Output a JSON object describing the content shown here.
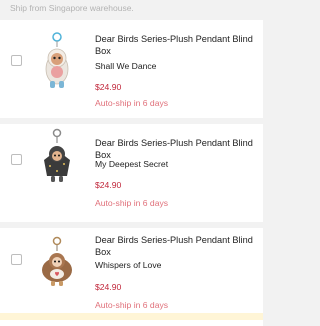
{
  "header": {
    "ship_text": "Ship from Singapore warehouse."
  },
  "items": [
    {
      "title": "Dear Birds Series-Plush Pendant Blind Box",
      "variant": "Shall We Dance",
      "price": "$24.90",
      "auto_ship": "Auto-ship in 6 days",
      "icon": "white-owl-plush-pendant",
      "color": "#e8ded2"
    },
    {
      "title": "Dear Birds Series-Plush Pendant Blind Box",
      "variant": "My Deepest Secret",
      "price": "$24.90",
      "auto_ship": "Auto-ship in 6 days",
      "icon": "black-bird-plush-pendant",
      "color": "#3a3a3a"
    },
    {
      "title": "Dear Birds Series-Plush Pendant Blind Box",
      "variant": "Whispers of Love",
      "price": "$24.90",
      "auto_ship": "Auto-ship in 6 days",
      "icon": "brown-owl-plush-pendant",
      "color": "#9a6a45"
    }
  ],
  "colors": {
    "price": "#c0263a",
    "auto_ship": "#e0707a",
    "background": "#f2f2f2"
  }
}
